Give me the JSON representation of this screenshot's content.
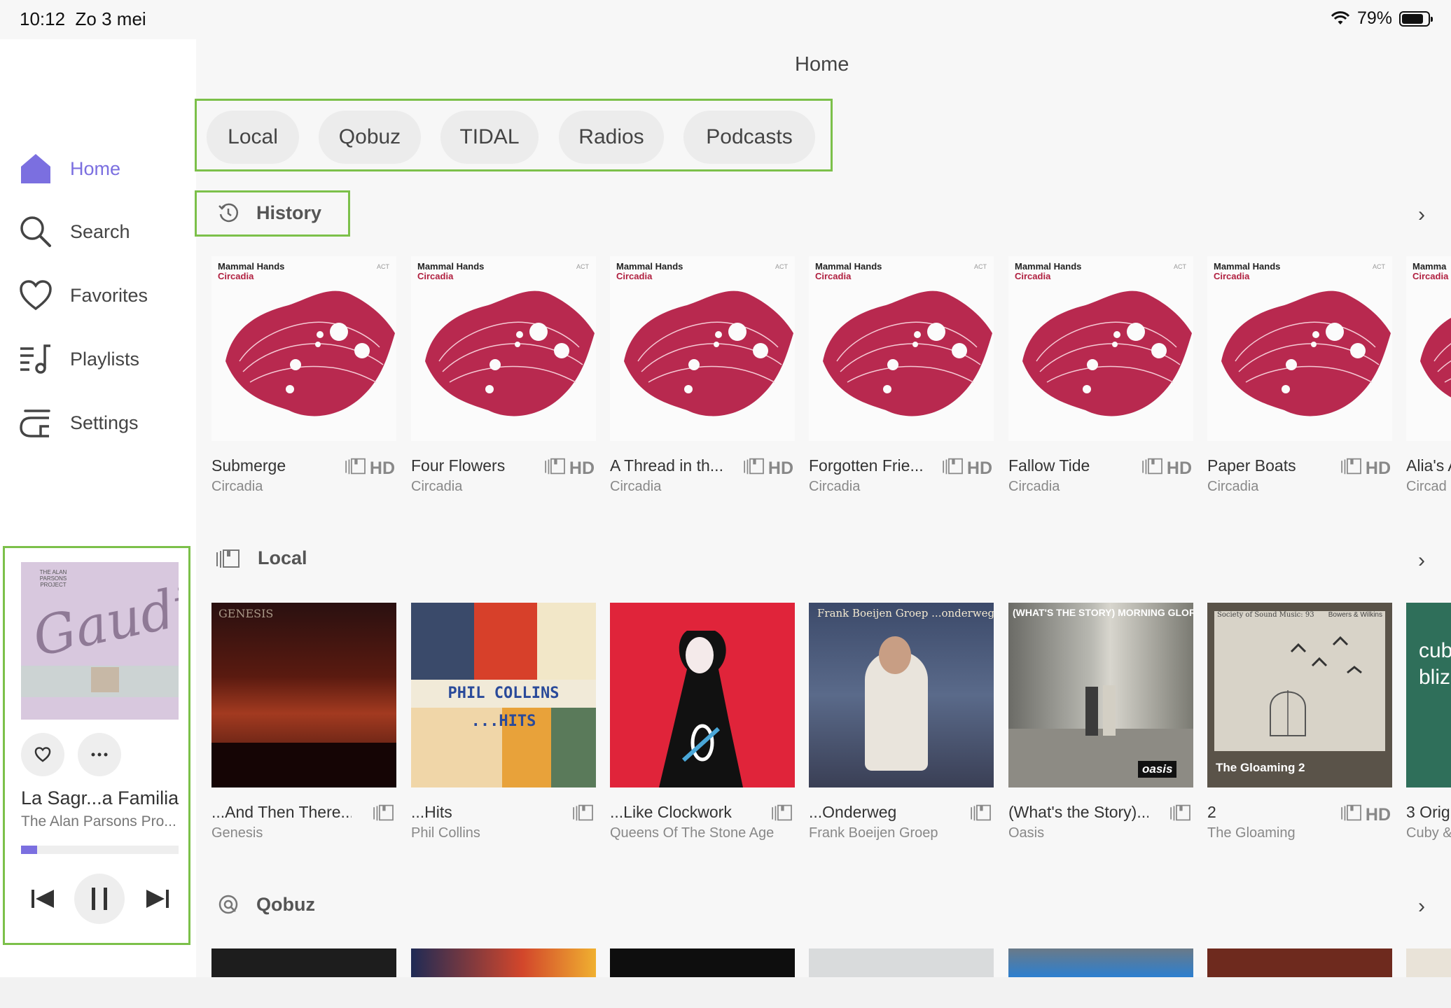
{
  "status_bar": {
    "time": "10:12",
    "date": "Zo 3 mei",
    "battery": "79%"
  },
  "sidebar": {
    "items": [
      {
        "label": "Home",
        "icon": "home-icon",
        "active": true
      },
      {
        "label": "Search",
        "icon": "search-icon"
      },
      {
        "label": "Favorites",
        "icon": "heart-icon"
      },
      {
        "label": "Playlists",
        "icon": "playlist-icon"
      },
      {
        "label": "Settings",
        "icon": "settings-icon"
      }
    ]
  },
  "now_playing": {
    "title": "La Sagr...a Familia",
    "artist": "The Alan Parsons Pro...",
    "cover_small_text": "THE ALAN PARSONS PROJECT",
    "cover_script": "Gaudi",
    "progress": 0.1
  },
  "header": {
    "title": "Home"
  },
  "tabs": [
    "Local",
    "Qobuz",
    "TIDAL",
    "Radios",
    "Podcasts"
  ],
  "sections": {
    "history": {
      "title": "History",
      "items": [
        {
          "title": "Submerge",
          "subtitle": "Circadia",
          "quality": "HD",
          "art_artist": "Mammal Hands",
          "art_album": "Circadia",
          "art_label": "ACT"
        },
        {
          "title": "Four Flowers",
          "subtitle": "Circadia",
          "quality": "HD",
          "art_artist": "Mammal Hands",
          "art_album": "Circadia",
          "art_label": "ACT"
        },
        {
          "title": "A Thread in th...",
          "subtitle": "Circadia",
          "quality": "HD",
          "art_artist": "Mammal Hands",
          "art_album": "Circadia",
          "art_label": "ACT"
        },
        {
          "title": "Forgotten Frie...",
          "subtitle": "Circadia",
          "quality": "HD",
          "art_artist": "Mammal Hands",
          "art_album": "Circadia",
          "art_label": "ACT"
        },
        {
          "title": "Fallow Tide",
          "subtitle": "Circadia",
          "quality": "HD",
          "art_artist": "Mammal Hands",
          "art_album": "Circadia",
          "art_label": "ACT"
        },
        {
          "title": "Paper Boats",
          "subtitle": "Circadia",
          "quality": "HD",
          "art_artist": "Mammal Hands",
          "art_album": "Circadia",
          "art_label": "ACT"
        },
        {
          "title": "Alia's A",
          "subtitle": "Circad",
          "quality": "",
          "art_artist": "Mamma",
          "art_album": "Circadia",
          "art_label": ""
        }
      ]
    },
    "local": {
      "title": "Local",
      "items": [
        {
          "title": "...And Then There...",
          "subtitle": "Genesis",
          "quality": ""
        },
        {
          "title": "...Hits",
          "subtitle": "Phil Collins",
          "quality": "",
          "art_text": "PHIL COLLINS ...HITS"
        },
        {
          "title": "...Like Clockwork",
          "subtitle": "Queens Of The Stone Age",
          "quality": ""
        },
        {
          "title": "...Onderweg",
          "subtitle": "Frank Boeijen Groep",
          "quality": "",
          "art_text": "Frank Boeijen Groep ...onderweg"
        },
        {
          "title": "(What's the Story)...",
          "subtitle": "Oasis",
          "quality": "",
          "art_text": "(WHAT'S THE STORY) MORNING GLORY ?",
          "art_badge": "oasis"
        },
        {
          "title": "2",
          "subtitle": "The Gloaming",
          "quality": "HD",
          "art_text": "The Gloaming 2",
          "art_top_left": "Society of Sound Music: 93",
          "art_top_right": "Bowers & Wilkins"
        },
        {
          "title": "3 Orig",
          "subtitle": "Cuby &",
          "quality": "",
          "art_text": "cub bliz"
        }
      ]
    },
    "qobuz": {
      "title": "Qobuz"
    }
  },
  "colors": {
    "accent": "#7b6fe0",
    "highlight_box": "#7cc04a",
    "mammal_red": "#b02040"
  }
}
